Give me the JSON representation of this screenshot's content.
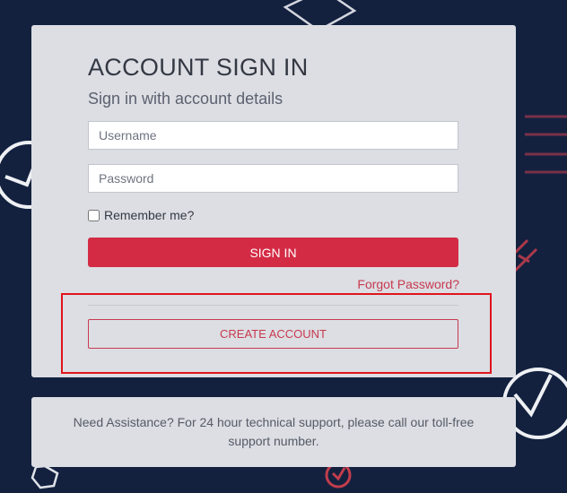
{
  "login": {
    "title": "ACCOUNT SIGN IN",
    "subtitle": "Sign in with account details",
    "username_placeholder": "Username",
    "password_placeholder": "Password",
    "remember_label": "Remember me?",
    "sign_in_label": "SIGN IN",
    "forgot_label": "Forgot Password?",
    "create_account_label": "CREATE ACCOUNT"
  },
  "support": {
    "text": "Need Assistance? For 24 hour technical support, please call our toll-free support number."
  },
  "colors": {
    "background": "#13213f",
    "card": "#dcdee3",
    "accent": "#d42b45",
    "highlight_box": "#e0141d"
  },
  "icons": [
    "clock-icon",
    "laptop-icon",
    "stopwatch-icon",
    "pencil-icon",
    "hexagon-icon",
    "swirl-icon"
  ]
}
